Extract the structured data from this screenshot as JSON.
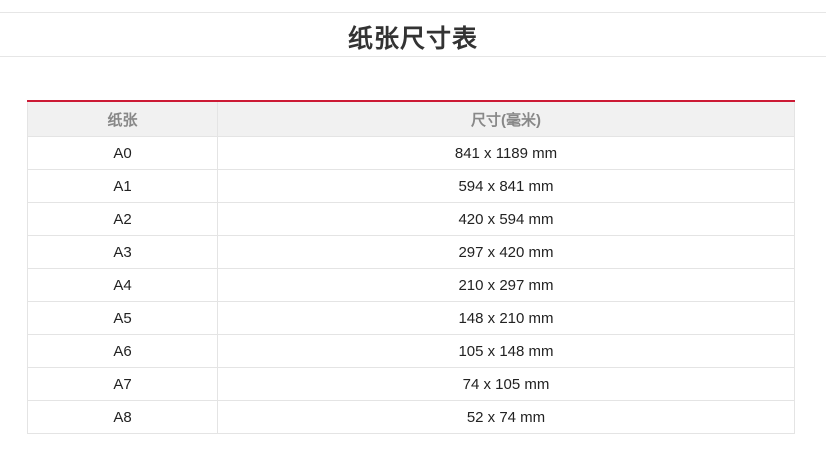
{
  "page": {
    "title": "纸张尺寸表"
  },
  "table": {
    "columns": [
      "纸张",
      "尺寸(毫米)"
    ],
    "rows": [
      {
        "paper": "A0",
        "size": "841 x 1189 mm"
      },
      {
        "paper": "A1",
        "size": "594 x 841 mm"
      },
      {
        "paper": "A2",
        "size": "420 x 594 mm"
      },
      {
        "paper": "A3",
        "size": "297 x 420 mm"
      },
      {
        "paper": "A4",
        "size": "210 x 297 mm"
      },
      {
        "paper": "A5",
        "size": "148 x 210 mm"
      },
      {
        "paper": "A6",
        "size": "105 x 148 mm"
      },
      {
        "paper": "A7",
        "size": "74 x 105 mm"
      },
      {
        "paper": "A8",
        "size": "52 x 74 mm"
      }
    ]
  },
  "colors": {
    "accent": "#cc1a35",
    "header_bg": "#f1f1f1",
    "header_text": "#888888",
    "border": "#e4e4e4"
  }
}
